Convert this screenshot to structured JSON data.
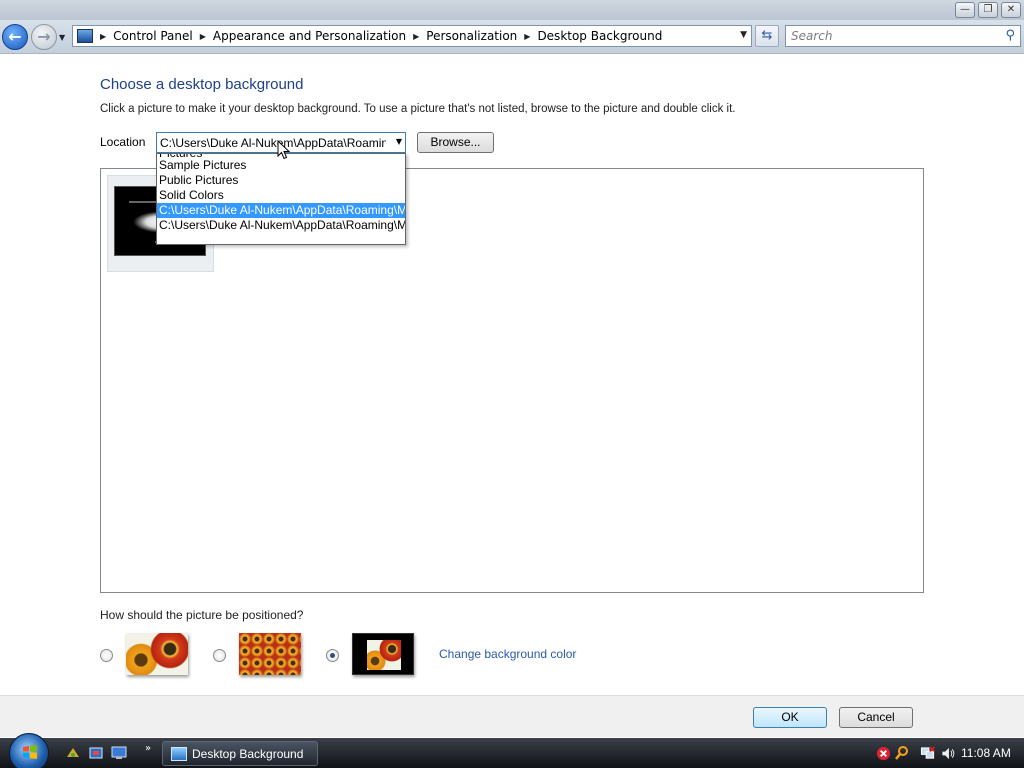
{
  "window": {
    "minimize_glyph": "—",
    "maximize_glyph": "❐",
    "close_glyph": "✕"
  },
  "toolbar": {
    "back_glyph": "←",
    "forward_glyph": "→",
    "breadcrumbs": [
      "Control Panel",
      "Appearance and Personalization",
      "Personalization",
      "Desktop Background"
    ],
    "refresh_glyph": "⇆",
    "search_placeholder": "Search"
  },
  "page": {
    "heading": "Choose a desktop background",
    "instructions": "Click a picture to make it your desktop background. To use a picture that's not listed, browse to the picture and double click it.",
    "location_label": "Location",
    "location_value": "C:\\Users\\Duke Al-Nukem\\AppData\\Roaming\\Microsoft",
    "browse_label": "Browse...",
    "location_options": [
      "Pictures",
      "Sample Pictures",
      "Public Pictures",
      "Solid Colors",
      "C:\\Users\\Duke Al-Nukem\\AppData\\Roaming\\Microsoft",
      "C:\\Users\\Duke Al-Nukem\\AppData\\Roaming\\Microsoft"
    ],
    "selected_option_index": 4,
    "position_question": "How should the picture be positioned?",
    "position_selected": "center",
    "change_color_link": "Change background color"
  },
  "footer": {
    "ok_label": "OK",
    "cancel_label": "Cancel"
  },
  "taskbar": {
    "task_label": "Desktop Background",
    "show_more_glyph": "»",
    "clock": "11:08 AM"
  },
  "colors": {
    "accent": "#1e3f8b",
    "link": "#2a5ba8",
    "selection": "#3399ff"
  }
}
